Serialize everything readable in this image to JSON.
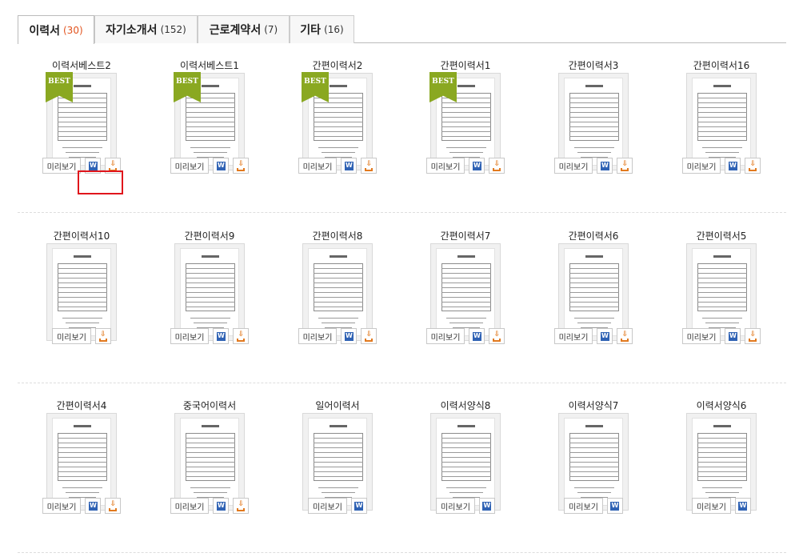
{
  "tabs": [
    {
      "label": "이력서",
      "count": "(30)",
      "active": true
    },
    {
      "label": "자기소개서",
      "count": "(152)",
      "active": false
    },
    {
      "label": "근로계약서",
      "count": "(7)",
      "active": false
    },
    {
      "label": "기타",
      "count": "(16)",
      "active": false
    }
  ],
  "buttons": {
    "preview_label": "미리보기",
    "word_icon": "W",
    "download_icon": "download-icon"
  },
  "badge": {
    "best_label": "BEST"
  },
  "rows": [
    [
      {
        "title": "이력서베스트2",
        "best": true,
        "word": true,
        "download": true,
        "highlighted": true
      },
      {
        "title": "이력서베스트1",
        "best": true,
        "word": true,
        "download": true
      },
      {
        "title": "간편이력서2",
        "best": true,
        "word": true,
        "download": true
      },
      {
        "title": "간편이력서1",
        "best": true,
        "word": true,
        "download": true
      },
      {
        "title": "간편이력서3",
        "best": false,
        "word": true,
        "download": true
      },
      {
        "title": "간편이력서16",
        "best": false,
        "word": true,
        "download": true
      }
    ],
    [
      {
        "title": "간편이력서10",
        "best": false,
        "word": false,
        "download": true
      },
      {
        "title": "간편이력서9",
        "best": false,
        "word": true,
        "download": true
      },
      {
        "title": "간편이력서8",
        "best": false,
        "word": true,
        "download": true
      },
      {
        "title": "간편이력서7",
        "best": false,
        "word": true,
        "download": true
      },
      {
        "title": "간편이력서6",
        "best": false,
        "word": true,
        "download": true
      },
      {
        "title": "간편이력서5",
        "best": false,
        "word": true,
        "download": true
      }
    ],
    [
      {
        "title": "간편이력서4",
        "best": false,
        "word": true,
        "download": true
      },
      {
        "title": "중국어이력서",
        "best": false,
        "word": true,
        "download": true
      },
      {
        "title": "일어이력서",
        "best": false,
        "word": true,
        "download": false
      },
      {
        "title": "이력서양식8",
        "best": false,
        "word": true,
        "download": false
      },
      {
        "title": "이력서양식7",
        "best": false,
        "word": true,
        "download": false
      },
      {
        "title": "이력서양식6",
        "best": false,
        "word": true,
        "download": false
      }
    ]
  ]
}
